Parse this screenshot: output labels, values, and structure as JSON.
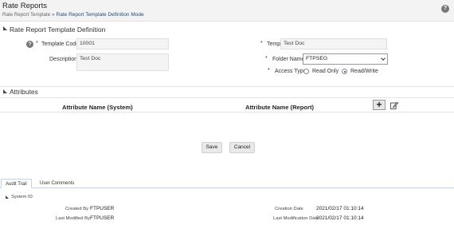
{
  "header": {
    "app_title": "Rate Reports",
    "breadcrumb_parent": "Rate Report Template",
    "breadcrumb_sep": "»",
    "breadcrumb_current": "Rate Report Template Definition Mode",
    "help_glyph": "?"
  },
  "definition": {
    "section_title": "Rate Report Template Definition",
    "help_glyph": "?",
    "template_code": {
      "label": "Template Code",
      "value": "10001"
    },
    "template_name": {
      "label": "Template Name",
      "value": "Test Doc"
    },
    "description": {
      "label": "Description",
      "value": "Test Doc"
    },
    "folder_name": {
      "label": "Folder Name",
      "value": "FTPSEG"
    },
    "access_type": {
      "label": "Access Type",
      "options": [
        "Read Only",
        "Read/Write"
      ],
      "selected": "Read/Write"
    },
    "required_marker": "*"
  },
  "attributes": {
    "section_title": "Attributes",
    "columns": [
      "Attribute Name (System)",
      "Attribute Name (Report)"
    ],
    "add_glyph": "+",
    "edit_icon": "edit-icon"
  },
  "actions": {
    "save_label": "Save",
    "cancel_label": "Cancel"
  },
  "tabs": [
    {
      "label": "Audit Trail",
      "active": true
    },
    {
      "label": "User Comments",
      "active": false
    }
  ],
  "audit": {
    "system_id_label": "System ID:",
    "created_by_label": "Created By",
    "created_by_value": "FTPUSER",
    "last_modified_by_label": "Last Modified By",
    "last_modified_by_value": "FTPUSER",
    "creation_date_label": "Creation Date",
    "creation_date_value": "2021/02/17 01:10:14",
    "last_modification_date_label": "Last Modification Date",
    "last_modification_date_value": "2021/02/17 01:10:14"
  }
}
